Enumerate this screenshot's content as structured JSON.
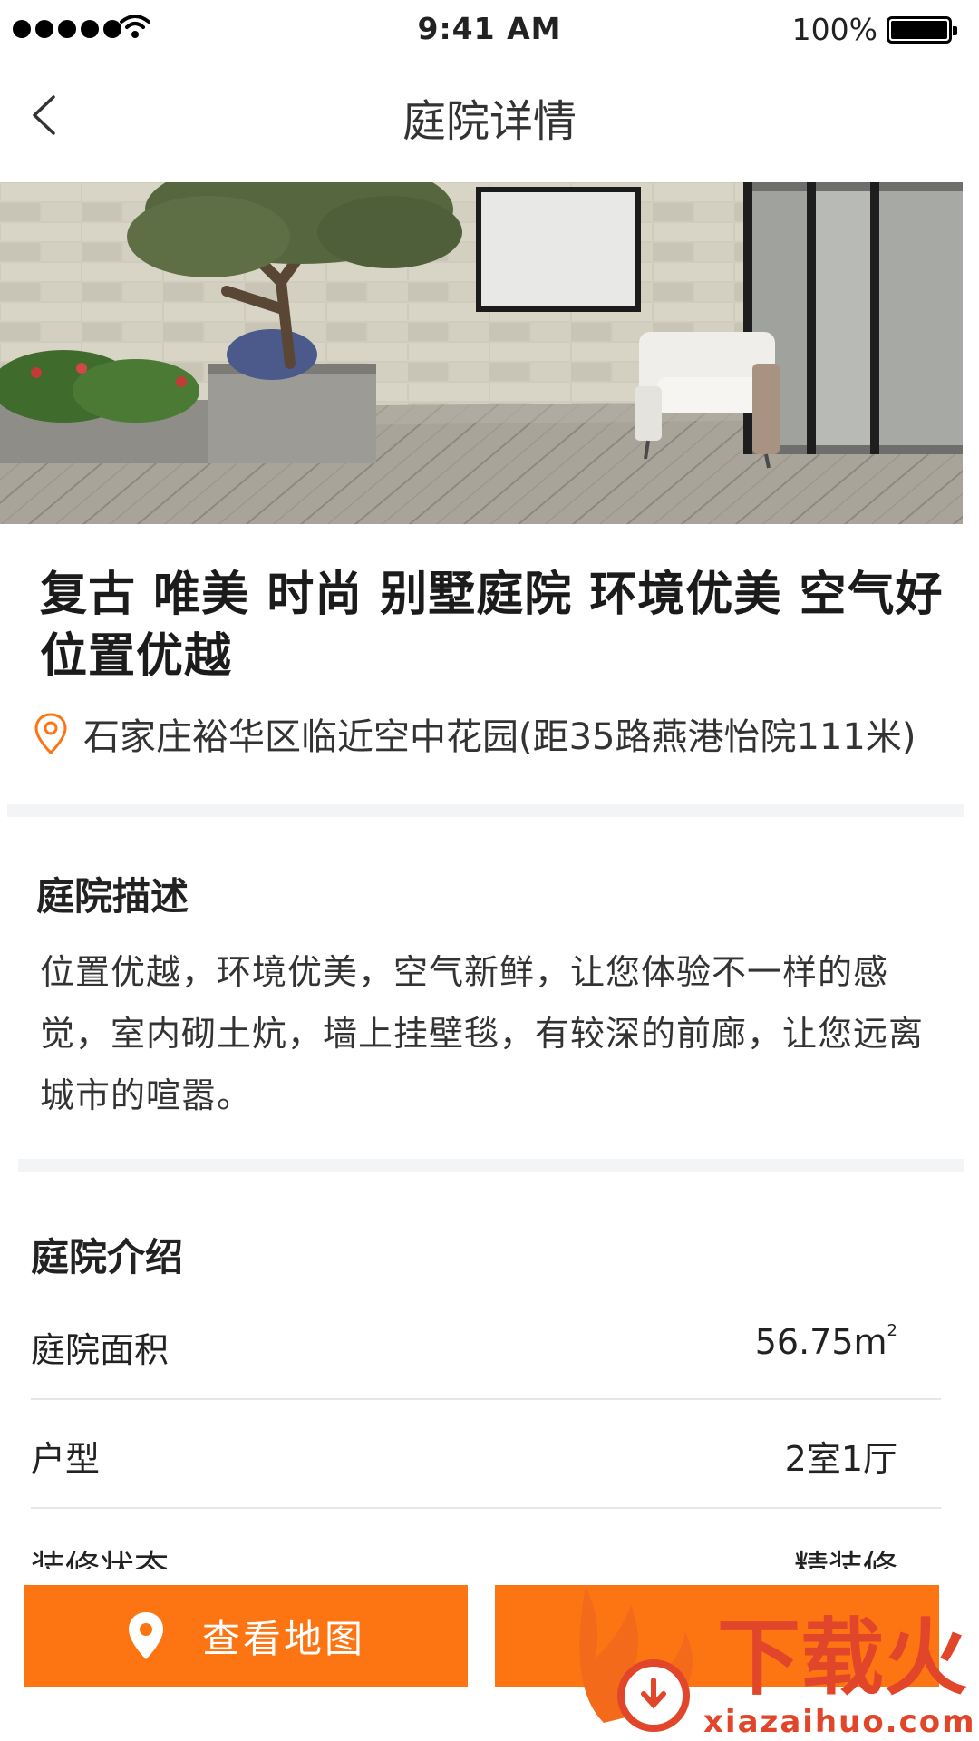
{
  "status_bar": {
    "time": "9:41 AM",
    "battery_percent": "100%",
    "signal_icon": "signal-dots-icon",
    "wifi_icon": "wifi-icon",
    "battery_icon": "battery-icon"
  },
  "nav": {
    "title": "庭院详情",
    "back_icon": "chevron-left-icon"
  },
  "listing": {
    "title": "复古 唯美 时尚 别墅庭院 环境优美 空气好 位置优越",
    "location_icon": "location-pin-icon",
    "address": "石家庄裕华区临近空中花园(距35路燕港怡院111米)"
  },
  "description": {
    "heading": "庭院描述",
    "text": "位置优越，环境优美，空气新鲜，让您体验不一样的感觉，室内砌土炕，墙上挂壁毯，有较深的前廊，让您远离城市的喧嚣。"
  },
  "intro": {
    "heading": "庭院介绍",
    "rows": [
      {
        "label": "庭院面积",
        "value": "56.75m",
        "value_sup": "2"
      },
      {
        "label": "户型",
        "value": "2室1厅"
      },
      {
        "label": "装修状态",
        "value": "精装修"
      }
    ]
  },
  "bottom_bar": {
    "map_button_label": "查看地图",
    "map_icon": "map-pin-icon",
    "contact_button_label": "",
    "accent_color": "#fd7513"
  },
  "watermark": {
    "brand": "下载火",
    "domain": "xiazaihuo.com"
  }
}
